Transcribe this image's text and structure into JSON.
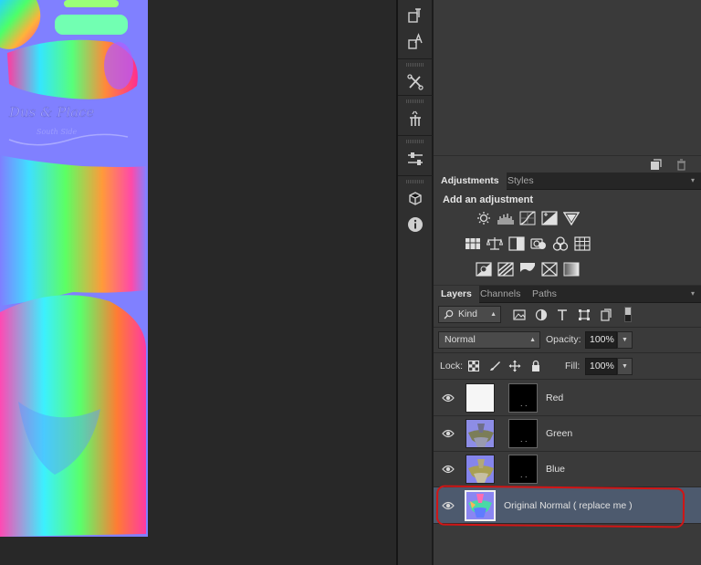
{
  "panels": {
    "adjustments": {
      "tabs": [
        {
          "label": "Adjustments",
          "active": true
        },
        {
          "label": "Styles",
          "active": false
        }
      ],
      "title": "Add an adjustment",
      "rows": [
        [
          "brightness-contrast-icon",
          "levels-icon",
          "curves-icon",
          "exposure-icon",
          "vibrance-icon"
        ],
        [
          "hue-saturation-icon",
          "color-balance-icon",
          "black-white-icon",
          "photo-filter-icon",
          "channel-mixer-icon",
          "color-lookup-icon"
        ],
        [
          "invert-icon",
          "posterize-icon",
          "threshold-icon",
          "selective-color-icon",
          "gradient-map-icon"
        ]
      ]
    },
    "layers": {
      "tabs": [
        {
          "label": "Layers",
          "active": true
        },
        {
          "label": "Channels",
          "active": false
        },
        {
          "label": "Paths",
          "active": false
        }
      ],
      "filter_kind": "Kind",
      "blend_mode": "Normal",
      "opacity_label": "Opacity:",
      "opacity_value": "100%",
      "lock_label": "Lock:",
      "fill_label": "Fill:",
      "fill_value": "100%",
      "items": [
        {
          "name": "Red",
          "visible": true,
          "thumb": "white",
          "selected": false
        },
        {
          "name": "Green",
          "visible": true,
          "thumb": "normal-map",
          "selected": false
        },
        {
          "name": "Blue",
          "visible": true,
          "thumb": "normal-map",
          "selected": false
        },
        {
          "name": "Original Normal ( replace me )",
          "visible": true,
          "thumb": "normal-map-color",
          "selected": true
        }
      ]
    }
  },
  "colors": {
    "panel_bg": "#3a3a3a",
    "selected_layer": "#4d5a6e",
    "annotation_red": "#d11515",
    "normal_map_base": "#8080ff"
  }
}
